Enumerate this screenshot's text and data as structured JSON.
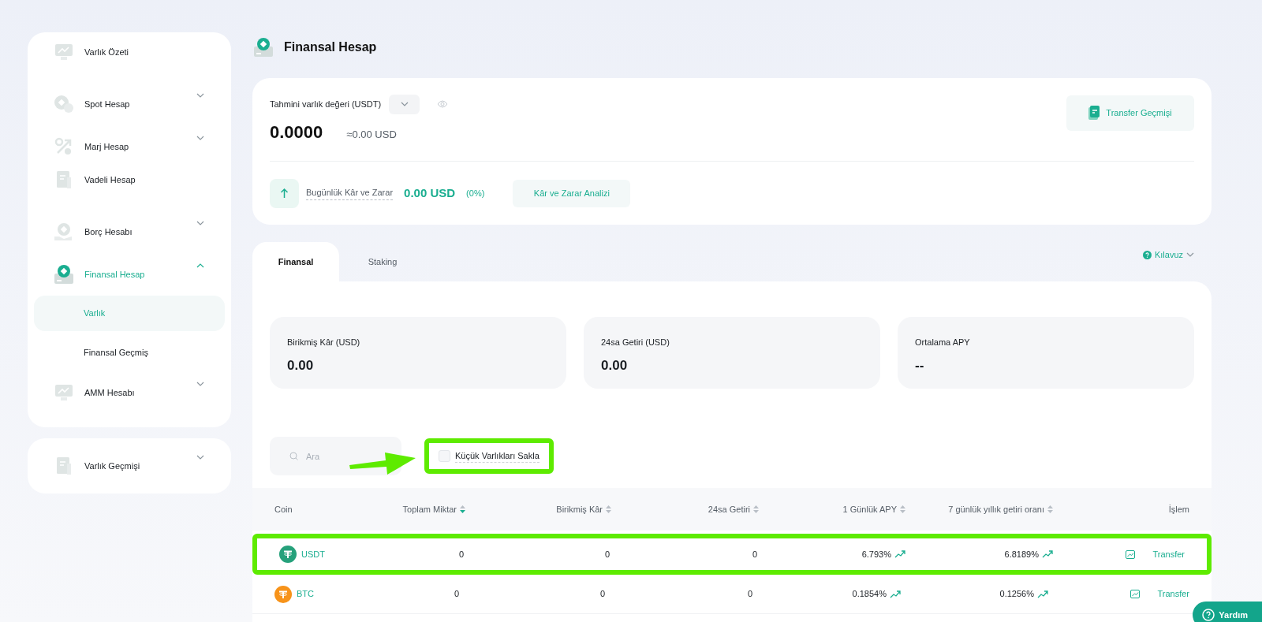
{
  "sidebar": {
    "items": [
      {
        "label": "Varlık Özeti",
        "selected": false
      },
      {
        "label": "Spot Hesap",
        "expanded": false,
        "selected": false
      },
      {
        "label": "Marj Hesap",
        "expanded": false,
        "selected": false
      },
      {
        "label": "Vadeli Hesap",
        "selected": false
      },
      {
        "label": "Borç Hesabı",
        "expanded": false,
        "selected": false
      },
      {
        "label": "Finansal Hesap",
        "expanded": true,
        "selected": true,
        "children": [
          {
            "label": "Varlık",
            "selected": true
          },
          {
            "label": "Finansal Geçmiş",
            "selected": false
          }
        ]
      },
      {
        "label": "AMM Hesabı",
        "expanded": false,
        "selected": false
      }
    ],
    "footer_item": {
      "label": "Varlık Geçmişi",
      "expanded": false
    }
  },
  "page_title": "Finansal Hesap",
  "summary": {
    "label": "Tahmini varlık değeri (USDT)",
    "value": "0.0000",
    "approx": "≈0.00 USD",
    "pnl_label": "Bugünlük Kâr ve Zarar",
    "pnl_value": "0.00 USD",
    "pnl_percent": "(0%)",
    "analysis_button": "Kâr ve Zarar Analizi",
    "history_button": "Transfer Geçmişi"
  },
  "tabs": [
    {
      "label": "Finansal",
      "selected": true
    },
    {
      "label": "Staking",
      "selected": false
    }
  ],
  "guide": "Kılavuz",
  "stats": [
    {
      "label": "Birikmiş Kâr (USD)",
      "value": "0.00"
    },
    {
      "label": "24sa Getiri (USD)",
      "value": "0.00"
    },
    {
      "label": "Ortalama APY",
      "value": "--"
    }
  ],
  "search": {
    "placeholder": "Ara"
  },
  "hide_small": {
    "label": "Küçük Varlıkları Sakla",
    "checked": false,
    "highlighted": true
  },
  "table": {
    "columns": [
      {
        "label": "Coin"
      },
      {
        "label": "Toplam Miktar",
        "sorted": true
      },
      {
        "label": "Birikmiş Kâr",
        "sorted": false
      },
      {
        "label": "24sa Getiri",
        "sorted": false
      },
      {
        "label": "1 Günlük APY",
        "sorted": false
      },
      {
        "label": "7 günlük yıllık getiri oranı",
        "sorted": false
      },
      {
        "label": "İşlem"
      }
    ],
    "rows": [
      {
        "coin": "USDT",
        "color": "#26a17b",
        "total": "0",
        "accrued": "0",
        "yield_24h": "0",
        "apy_1d": "6.793%",
        "apy_7d": "6.8189%",
        "action": "Transfer",
        "highlighted": true
      },
      {
        "coin": "BTC",
        "color": "#f7931a",
        "total": "0",
        "accrued": "0",
        "yield_24h": "0",
        "apy_1d": "0.1854%",
        "apy_7d": "0.1256%",
        "action": "Transfer",
        "highlighted": false
      }
    ]
  },
  "help_button": "Yardım"
}
